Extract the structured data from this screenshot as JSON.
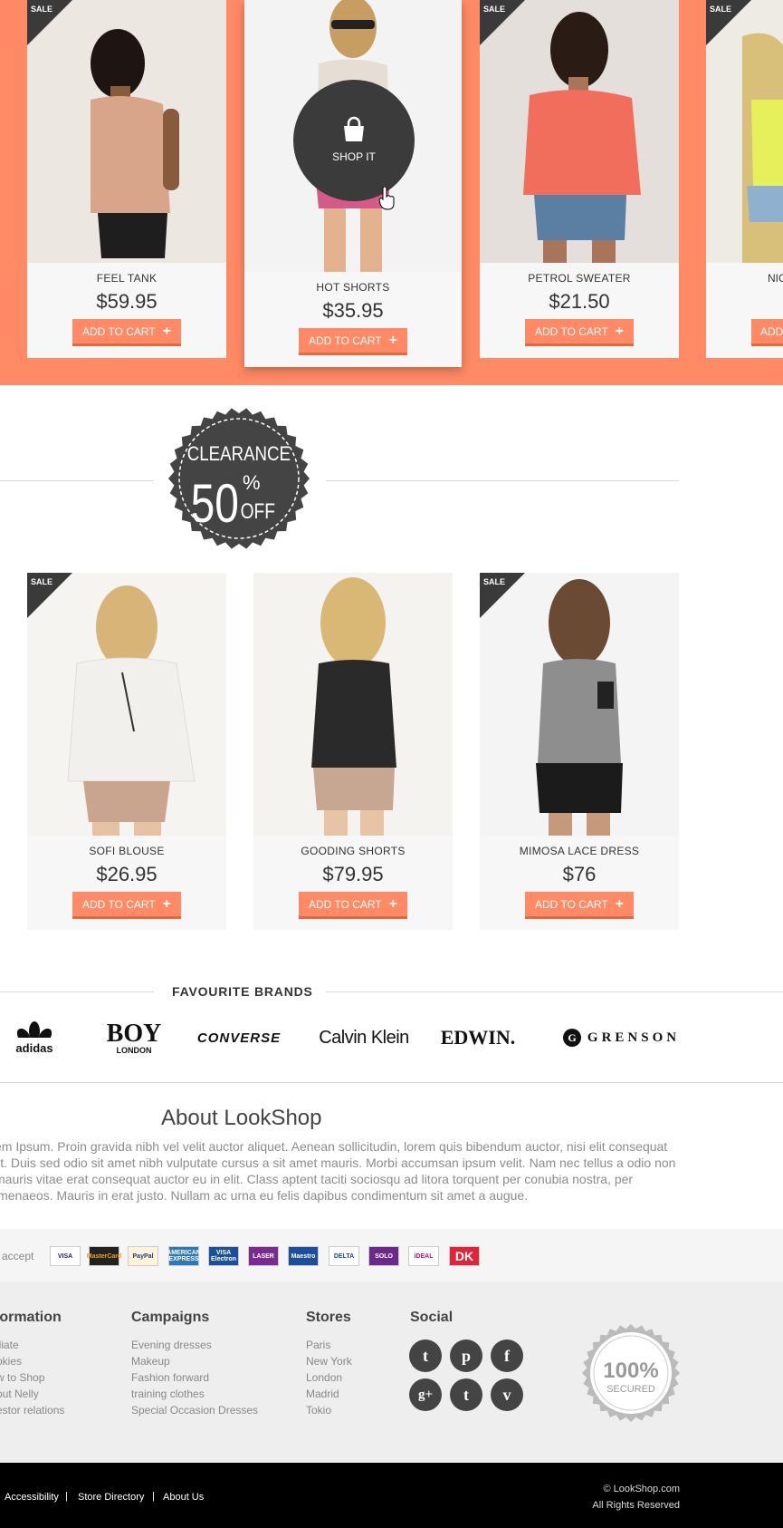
{
  "sale_label": "SALE",
  "shop_it_label": "SHOP IT",
  "featured": [
    {
      "name": "FEEL TANK",
      "price": "$59.95",
      "cart": "ADD TO CART"
    },
    {
      "name": "HOT SHORTS",
      "price": "$35.95",
      "cart": "ADD TO CART"
    },
    {
      "name": "PETROL SWEATER",
      "price": "$21.50",
      "cart": "ADD TO CART"
    },
    {
      "name": "NIC",
      "cart": "ADD"
    }
  ],
  "clearance": {
    "word": "CLEARANCE",
    "amount": "50",
    "percent": "%",
    "off": "OFF"
  },
  "sale_items": [
    {
      "name": "SOFI BLOUSE",
      "price": "$26.95",
      "cart": "ADD TO CART"
    },
    {
      "name": "GOODING SHORTS",
      "price": "$79.95",
      "cart": "ADD TO CART"
    },
    {
      "name": "MIMOSA LACE DRESS",
      "price": "$76",
      "cart": "ADD TO CART"
    }
  ],
  "brands": {
    "title": "FAVOURITE BRANDS",
    "items": [
      "adidas",
      "BOY",
      "LONDON",
      "CONVERSE",
      "Calvin Klein",
      "EDWIN.",
      "GRENSON"
    ]
  },
  "about": {
    "title": "About LookShop",
    "text": "em Ipsum. Proin gravida nibh vel velit auctor aliquet. Aenean sollicitudin, lorem quis bibendum auctor, nisi elit consequat lit. Duis sed odio sit amet nibh vulputate cursus a sit amet mauris. Morbi accumsan ipsum velit. Nam nec tellus a odio non  mauris vitae erat consequat auctor eu in elit. Class aptent taciti sociosqu ad litora torquent per conubia nostra, per imenaeos. Mauris in erat justo. Nullam ac urna eu felis dapibus condimentum sit amet a augue."
  },
  "payments": {
    "label": "e accept",
    "methods": [
      "VISA",
      "MasterCard",
      "PayPal",
      "AMERICAN EXPRESS",
      "VISA Electron",
      "LASER",
      "Maestro",
      "DELTA",
      "SOLO",
      "iDEAL",
      "DK"
    ]
  },
  "footer": {
    "columns": [
      {
        "title": "formation",
        "links": [
          "iliate",
          "okies",
          "w to Shop",
          "out Nelly",
          "estor relations"
        ]
      },
      {
        "title": "Campaigns",
        "links": [
          "Evening dresses",
          "Makeup",
          "Fashion forward",
          "training clothes",
          "Special Occasion Dresses"
        ]
      },
      {
        "title": "Stores",
        "links": [
          "Paris",
          "New York",
          "London",
          "Madrid",
          "Tokio"
        ]
      },
      {
        "title": "Social"
      }
    ],
    "social": [
      "t",
      "p",
      "f",
      "g+",
      "t",
      "v"
    ],
    "secured": {
      "big": "100%",
      "small": "SECURED"
    }
  },
  "bottom": {
    "links": [
      "Accessibility",
      "Store Directory",
      "About Us"
    ],
    "separator": "|",
    "copyright": "© LookShop.com",
    "rights": "All Rights Reserved"
  },
  "colors": {
    "accent": "#ff8a65",
    "dark": "#3b3b3b"
  }
}
